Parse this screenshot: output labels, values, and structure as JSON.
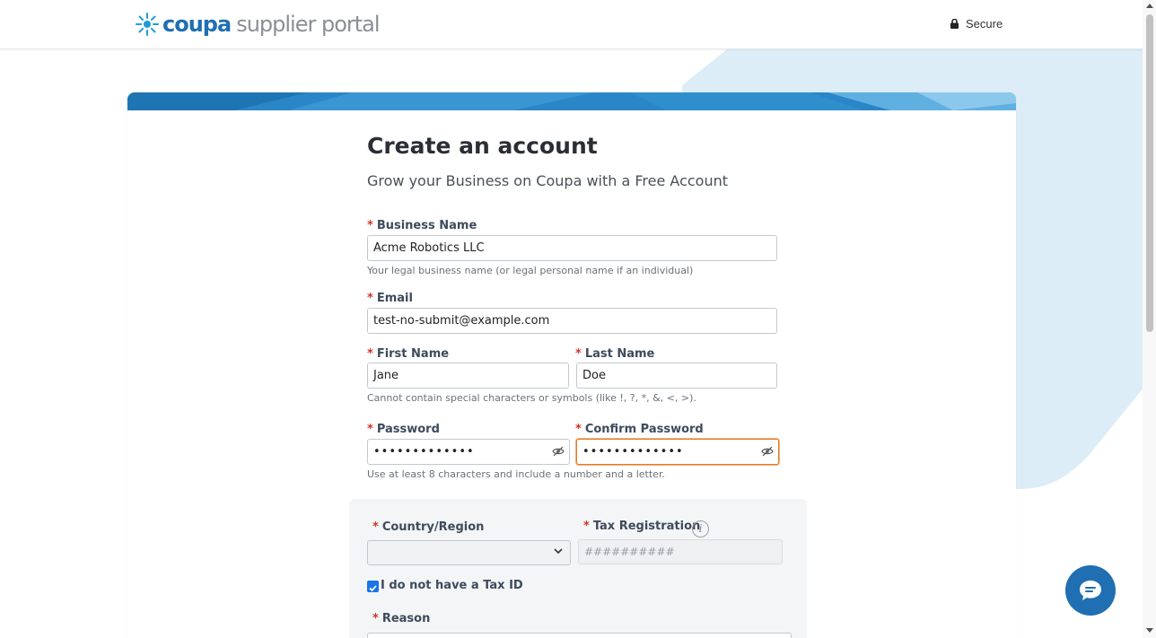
{
  "header": {
    "logo_brand": "coupa",
    "logo_product": "supplier portal",
    "secure_label": "Secure"
  },
  "form": {
    "title": "Create an account",
    "subtitle": "Grow your Business on Coupa with a Free Account",
    "required_marker": "*",
    "business_name": {
      "label": "Business Name",
      "value": "Acme Robotics LLC",
      "hint": "Your legal business name (or legal personal name if an individual)"
    },
    "email": {
      "label": "Email",
      "value": "test-no-submit@example.com"
    },
    "first_name": {
      "label": "First Name",
      "value": "Jane"
    },
    "last_name": {
      "label": "Last Name",
      "value": "Doe"
    },
    "name_hint": "Cannot contain special characters or symbols (like !, ?, *, &, <, >).",
    "password": {
      "label": "Password",
      "value": "•••••••••••••"
    },
    "confirm_password": {
      "label": "Confirm Password",
      "value": "•••••••••••••"
    },
    "password_hint": "Use at least 8 characters and include a number and a letter.",
    "country": {
      "label": "Country/Region",
      "value": ""
    },
    "tax_registration": {
      "label": "Tax Registration",
      "placeholder": "##########",
      "info_icon": "i"
    },
    "no_tax_id": {
      "label": "I do not have a Tax ID",
      "checked": true
    },
    "reason": {
      "label": "Reason"
    }
  },
  "colors": {
    "brand_blue": "#1f6fb2",
    "required_red": "#d0342c",
    "focus_orange": "#e07b2a",
    "checkbox_blue": "#1a73e8"
  },
  "icons": {
    "lock": "lock-icon",
    "eye_slash": "eye-slash-icon",
    "chevron": "chevron-down-icon",
    "chat": "chat-icon",
    "info": "info-icon"
  }
}
